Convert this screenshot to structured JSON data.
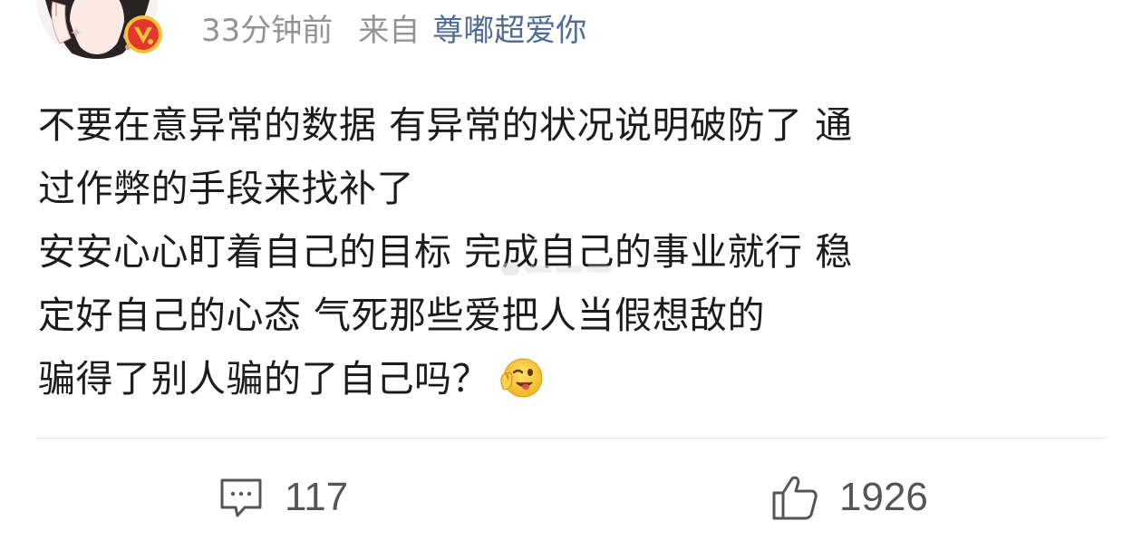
{
  "header": {
    "time": "33分钟前",
    "from_label": "来自",
    "source": "尊嘟超爱你"
  },
  "post": {
    "lines": [
      "不要在意异常的数据 有异常的状况说明破防了 通",
      "过作弊的手段来找补了",
      "安安心心盯着自己的目标 完成自己的事业就行 稳",
      "定好自己的心态 气死那些爱把人当假想敌的",
      "骗得了别人骗的了自己吗？"
    ],
    "emoji": "wink-emoji"
  },
  "actions": {
    "comments": "117",
    "likes": "1926"
  },
  "colors": {
    "meta_gray": "#939393",
    "source_blue": "#4f6b96",
    "text": "#1c1c1c",
    "icon": "#555555",
    "vip_gold": "#f5c33b",
    "vip_red": "#e2372b"
  }
}
